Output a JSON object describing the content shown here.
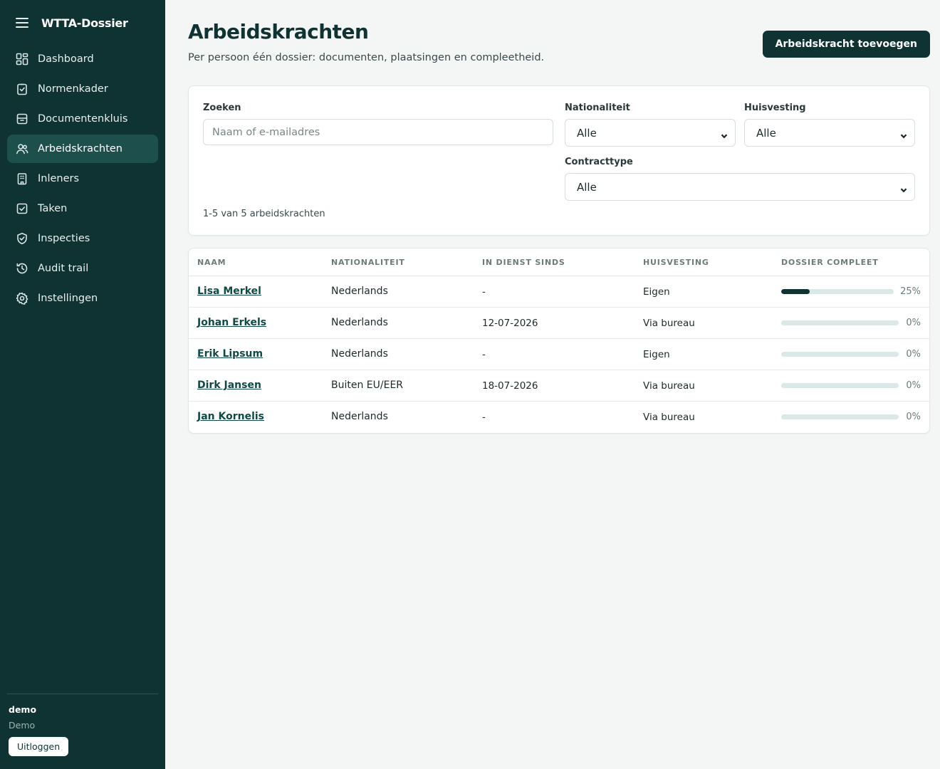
{
  "app": {
    "title": "WTTA-Dossier"
  },
  "sidebar": {
    "items": [
      {
        "label": "Dashboard",
        "icon": "dashboard-icon",
        "active": false
      },
      {
        "label": "Normenkader",
        "icon": "clipboard-check-icon",
        "active": false
      },
      {
        "label": "Documentenkluis",
        "icon": "archive-icon",
        "active": false
      },
      {
        "label": "Arbeidskrachten",
        "icon": "users-icon",
        "active": true
      },
      {
        "label": "Inleners",
        "icon": "building-icon",
        "active": false
      },
      {
        "label": "Taken",
        "icon": "checkbox-icon",
        "active": false
      },
      {
        "label": "Inspecties",
        "icon": "shield-check-icon",
        "active": false
      },
      {
        "label": "Audit trail",
        "icon": "history-icon",
        "active": false
      },
      {
        "label": "Instellingen",
        "icon": "gear-icon",
        "active": false
      }
    ],
    "user": {
      "name": "demo",
      "org": "Demo",
      "logout_label": "Uitloggen"
    }
  },
  "header": {
    "title": "Arbeidskrachten",
    "subtitle": "Per persoon één dossier: documenten, plaatsingen en compleetheid.",
    "add_button": "Arbeidskracht toevoegen"
  },
  "filters": {
    "search": {
      "label": "Zoeken",
      "placeholder": "Naam of e-mailadres",
      "value": ""
    },
    "nationality": {
      "label": "Nationaliteit",
      "value": "Alle"
    },
    "housing": {
      "label": "Huisvesting",
      "value": "Alle"
    },
    "contract": {
      "label": "Contracttype",
      "value": "Alle"
    },
    "result_count": "1-5 van 5 arbeidskrachten"
  },
  "table": {
    "columns": [
      "NAAM",
      "NATIONALITEIT",
      "IN DIENST SINDS",
      "HUISVESTING",
      "DOSSIER COMPLEET"
    ],
    "rows": [
      {
        "name": "Lisa Merkel",
        "nationality": "Nederlands",
        "since": "-",
        "housing": "Eigen",
        "complete": "25%",
        "progress": 0.25
      },
      {
        "name": "Johan Erkels",
        "nationality": "Nederlands",
        "since": "12-07-2026",
        "housing": "Via bureau",
        "complete": "0%",
        "progress": 0
      },
      {
        "name": "Erik Lipsum",
        "nationality": "Nederlands",
        "since": "-",
        "housing": "Eigen",
        "complete": "0%",
        "progress": 0
      },
      {
        "name": "Dirk Jansen",
        "nationality": "Buiten EU/EER",
        "since": "18-07-2026",
        "housing": "Via bureau",
        "complete": "0%",
        "progress": 0
      },
      {
        "name": "Jan Kornelis",
        "nationality": "Nederlands",
        "since": "-",
        "housing": "Via bureau",
        "complete": "0%",
        "progress": 0
      }
    ]
  },
  "colors": {
    "sidebar_bg": "#0f3232",
    "active_item_bg": "#1d4f4c",
    "accent": "#0f3232",
    "progress_track": "#dbe8e7",
    "page_bg": "#f4f6f5"
  }
}
